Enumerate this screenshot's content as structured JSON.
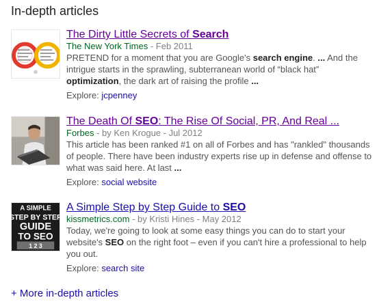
{
  "section_title": "In-depth articles",
  "articles": [
    {
      "title": "The Dirty Little Secrets of ",
      "title_highlight": "Search",
      "title_after": "",
      "site": "The New York Times",
      "meta": " - Feb 2011",
      "snippet_parts": [
        {
          "text": "PRETEND for a moment that you are Google's ",
          "bold": false
        },
        {
          "text": "search engine",
          "bold": true
        },
        {
          "text": ". ",
          "bold": false
        },
        {
          "text": "...",
          "bold": true
        },
        {
          "text": " And the intrigue starts in the sprawling, subterranean world of “black hat” ",
          "bold": false
        },
        {
          "text": "optimization",
          "bold": true
        },
        {
          "text": ", the dark art of raising the profile ",
          "bold": false
        },
        {
          "text": "...",
          "bold": true
        }
      ],
      "explore_label": "Explore: ",
      "explore_link": "jcpenney",
      "thumb_icon": "gauges-thumbnail"
    },
    {
      "title": "The Death Of ",
      "title_highlight": "SEO",
      "title_after": ": The Rise Of Social, PR, And Real ...",
      "site": "Forbes",
      "meta": " - by Ken Krogue - Jul 2012",
      "snippet_parts": [
        {
          "text": "This article has been ranked #1 on all of Forbes and has \"rankled\" thousands of people. There have been industry experts rise up in defense and offense to what was said here. At last ",
          "bold": false
        },
        {
          "text": "...",
          "bold": true
        }
      ],
      "explore_label": "Explore: ",
      "explore_link": "social website",
      "thumb_icon": "man-with-laptop-photo"
    },
    {
      "title": "A Simple Step by Step Guide to ",
      "title_highlight": "SEO",
      "title_after": "",
      "site": "kissmetrics.com",
      "meta": " - by Kristi Hines - May 2012",
      "snippet_parts": [
        {
          "text": "Today, we're going to look at some easy things you can do to start your website's ",
          "bold": false
        },
        {
          "text": "SEO",
          "bold": true
        },
        {
          "text": " on the right foot – even if you can't hire a professional to help you out.",
          "bold": false
        }
      ],
      "explore_label": "Explore: ",
      "explore_link": "search site",
      "thumb_icon": "seo-guide-cover",
      "thumb_text": [
        "A SIMPLE",
        "STEP BY STEP",
        "GUIDE",
        "TO SEO",
        "1 2 3"
      ]
    }
  ],
  "more_link": "+ More in-depth articles",
  "colors": {
    "link": "#1a0dab",
    "visited": "#660099",
    "site": "#006621",
    "meta": "#808080",
    "snippet": "#545454"
  }
}
